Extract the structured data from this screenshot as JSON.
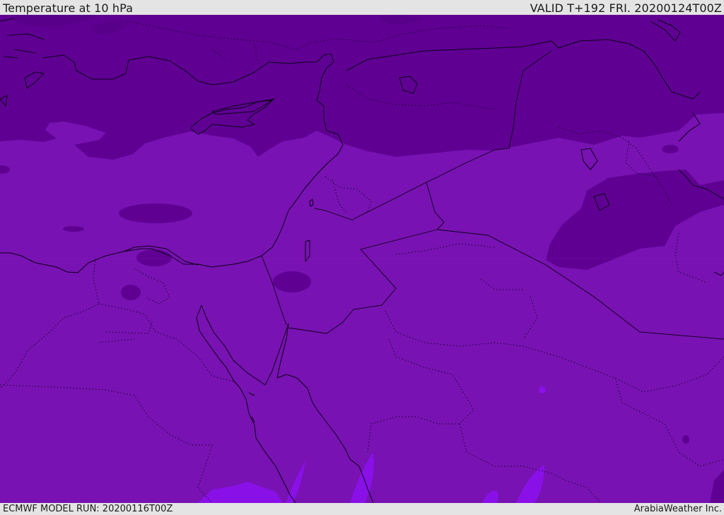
{
  "header": {
    "title": "Temperature at 10 hPa",
    "valid_time": "VALID T+192 FRI. 20200124T00Z"
  },
  "footer": {
    "model_run": "ECMWF MODEL RUN: 20200116T00Z",
    "credit": "ArabiaWeather Inc."
  },
  "map": {
    "field": "temperature",
    "colors": {
      "dark_band": "#5f0093",
      "mid_band": "#7812b2",
      "light_band": "#8a10e8",
      "coastline": "#0c0018"
    }
  }
}
